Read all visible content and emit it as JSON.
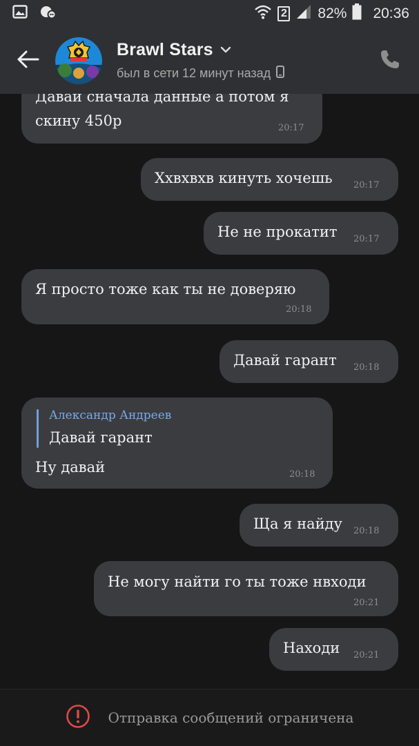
{
  "status_bar": {
    "sim_slot": "2",
    "battery": "82%",
    "time": "20:36",
    "icons": [
      "gallery-icon",
      "notification-icon",
      "wifi-icon",
      "signal-icon",
      "battery-icon"
    ]
  },
  "header": {
    "back_icon": "arrow-left-icon",
    "title": "Brawl Stars",
    "status": "был в сети 12 минут назад",
    "call_icon": "phone-icon",
    "colors": {
      "bar": "#2f3033",
      "title": "#f2f2f2",
      "status": "#a9a9a9"
    }
  },
  "messages": [
    {
      "direction": "incoming",
      "text_lines": [
        "Давай сначала данные а потом я",
        "скину 450р"
      ],
      "time": "20:17"
    },
    {
      "direction": "outgoing",
      "text": "Ххвхвхв кинуть хочешь",
      "time": "20:17"
    },
    {
      "direction": "outgoing",
      "text": "Не не прокатит",
      "time": "20:17"
    },
    {
      "direction": "incoming",
      "text": "Я просто тоже как ты не доверяю",
      "time": "20:18"
    },
    {
      "direction": "outgoing",
      "text": "Давай гарант",
      "time": "20:18"
    },
    {
      "direction": "incoming",
      "reply_author": "Александр Андреев",
      "reply_text": "Давай гарант",
      "text": "Ну давай",
      "time": "20:18"
    },
    {
      "direction": "outgoing",
      "text": "Ща я найду",
      "time": "20:18"
    },
    {
      "direction": "outgoing",
      "text": "Не могу найти го ты тоже нвходи",
      "time": "20:21"
    },
    {
      "direction": "outgoing",
      "text": "Находи",
      "time": "20:21"
    }
  ],
  "footer": {
    "icon": "warning-icon",
    "text": "Отправка сообщений ограничена",
    "accent": "#e04848"
  }
}
